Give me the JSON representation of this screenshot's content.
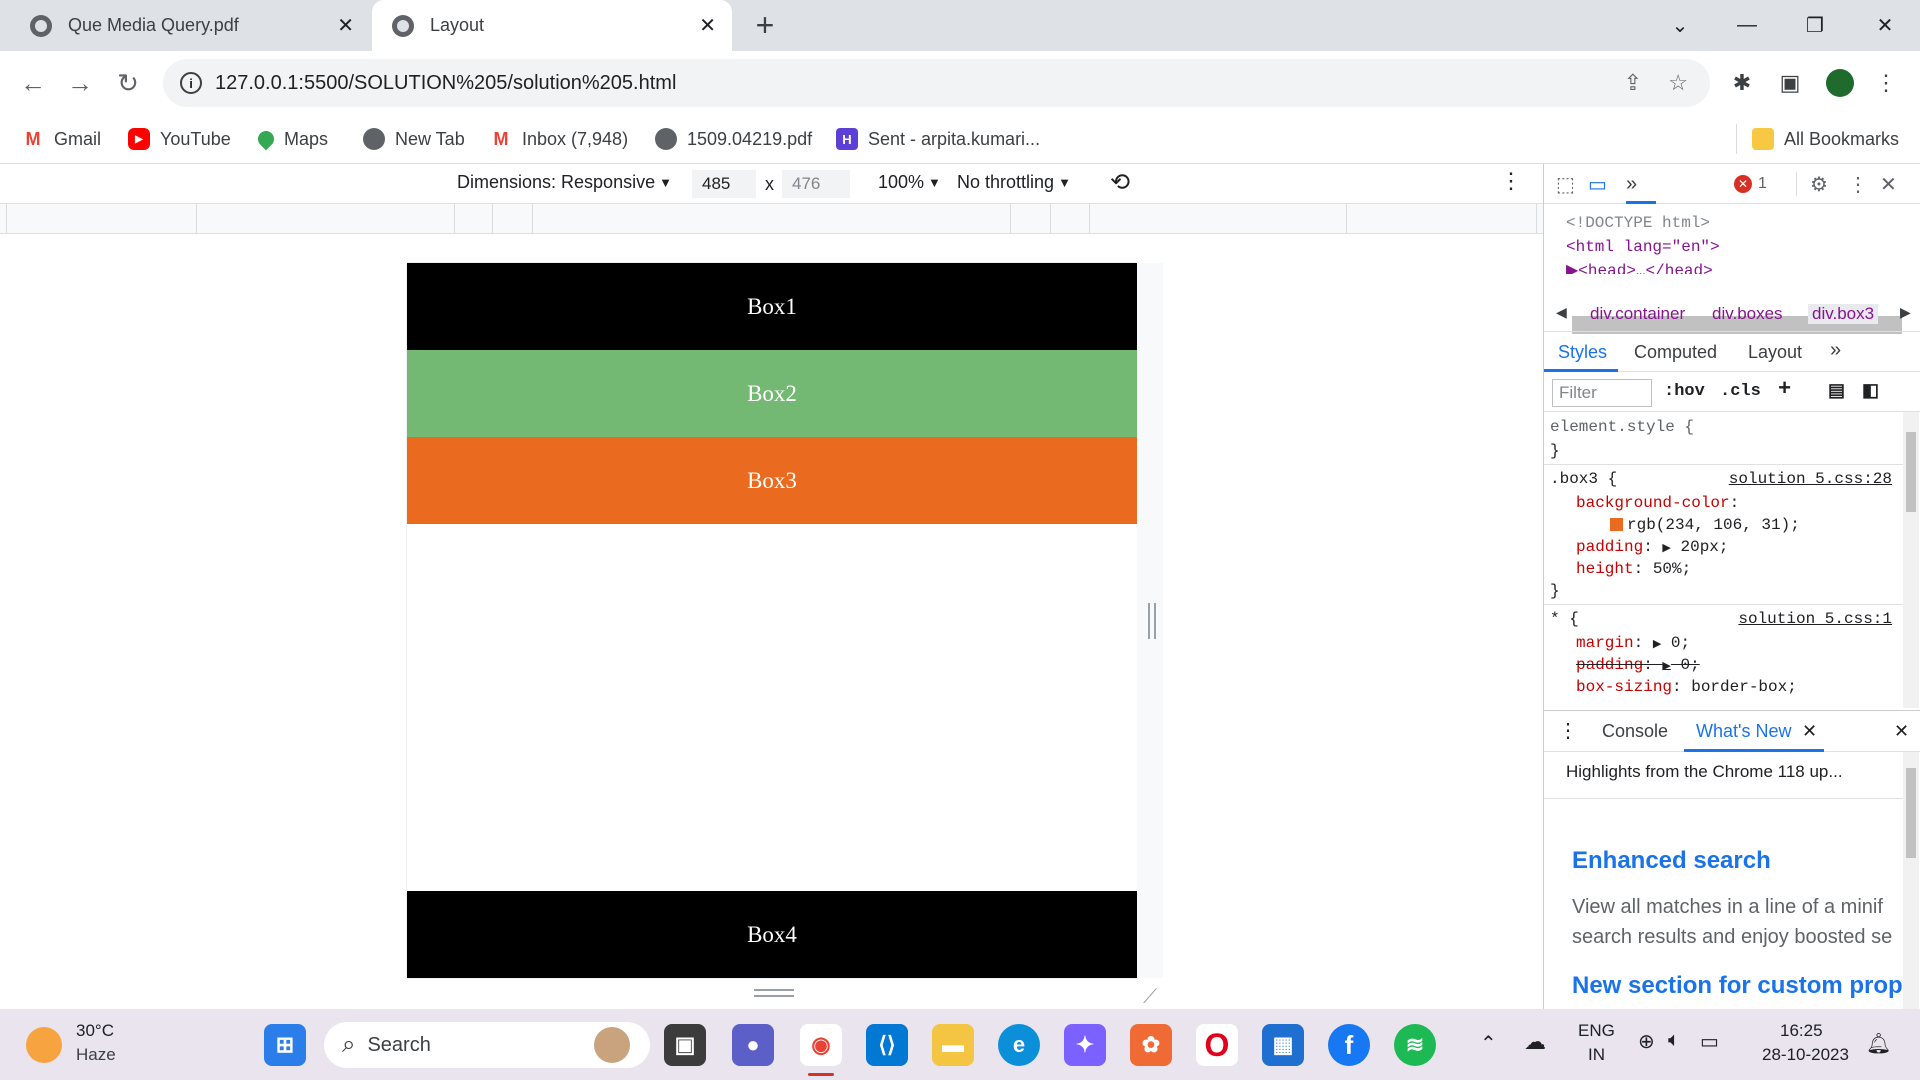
{
  "tabs": [
    {
      "title": "Que Media Query.pdf",
      "active": false
    },
    {
      "title": "Layout",
      "active": true
    }
  ],
  "window_controls": {
    "new_tab": "+",
    "tab_close": "✕"
  },
  "address_bar": {
    "url": "127.0.0.1:5500/SOLUTION%205/solution%205.html"
  },
  "bookmarks": [
    {
      "label": "Gmail",
      "icon": "gmail-icon"
    },
    {
      "label": "YouTube",
      "icon": "youtube-icon"
    },
    {
      "label": "Maps",
      "icon": "maps-icon"
    },
    {
      "label": "New Tab",
      "icon": "globe-icon"
    },
    {
      "label": "Inbox (7,948)",
      "icon": "gmail-icon"
    },
    {
      "label": "1509.04219.pdf",
      "icon": "globe-icon"
    },
    {
      "label": "Sent - arpita.kumari...",
      "icon": "mail-icon"
    }
  ],
  "all_bookmarks": "All Bookmarks",
  "device_toolbar": {
    "dimensions": "Dimensions: Responsive",
    "width": "485",
    "times": "x",
    "height": "476",
    "zoom": "100%",
    "throttling": "No throttling"
  },
  "page": {
    "boxes": [
      {
        "label": "Box1",
        "color": "#000000"
      },
      {
        "label": "Box2",
        "color": "#73b873"
      },
      {
        "label": "Box3",
        "color": "#ea6a1f"
      },
      {
        "label": "Box4",
        "color": "#000000"
      }
    ]
  },
  "devtools": {
    "error_count": "1",
    "elements": {
      "doctype": "<!DOCTYPE html>",
      "html_open": "<html lang=\"en\">",
      "head": "▶<head>…</head>"
    },
    "breadcrumbs": [
      "div.container",
      "div.boxes",
      "div.box3"
    ],
    "subtabs": [
      "Styles",
      "Computed",
      "Layout"
    ],
    "filter_placeholder": "Filter",
    "hov": ":hov",
    "cls": ".cls",
    "styles": {
      "element_style": "element.style {",
      "close_brace": "}",
      "rule1_selector": ".box3 {",
      "rule1_source": "solution 5.css:28",
      "rule1_prop1": "background-color",
      "rule1_val1": "rgb(234, 106, 31);",
      "rule1_prop2": "padding",
      "rule1_val2": "20px;",
      "rule1_prop3": "height",
      "rule1_val3": "50%;",
      "rule2_selector": "* {",
      "rule2_source": "solution 5.css:1",
      "rule2_prop1": "margin",
      "rule2_val1": "0;",
      "rule2_prop2": "padding",
      "rule2_val2": "0;",
      "rule2_prop3": "box-sizing",
      "rule2_val3": "border-box;"
    },
    "drawer_tabs": [
      "Console",
      "What's New"
    ],
    "whats_new": {
      "highlight": "Highlights from the Chrome 118 up...",
      "heading1": "Enhanced search",
      "para1_line1": "View all matches in a line of a minif",
      "para1_line2": "search results and enjoy boosted se",
      "heading2": "New section for custom prop"
    }
  },
  "taskbar": {
    "weather_temp": "30°C",
    "weather_desc": "Haze",
    "search": "Search",
    "lang_top": "ENG",
    "lang_bottom": "IN",
    "time": "16:25",
    "date": "28-10-2023"
  }
}
